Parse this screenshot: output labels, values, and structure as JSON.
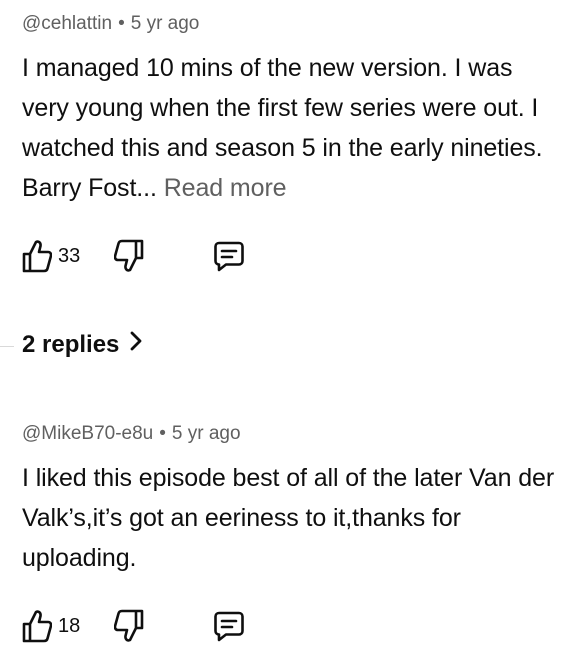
{
  "comments": [
    {
      "author": "@cehlattin",
      "separator": "•",
      "time": "5 yr ago",
      "text": "I managed 10 mins of the new version. I was very young when the first few series were out. I watched this and season 5 in the early nineties. Barry Fost...",
      "read_more": "Read more",
      "likes": "33",
      "icons": {
        "like": "thumbs-up-icon",
        "dislike": "thumbs-down-icon",
        "reply": "comment-reply-icon"
      }
    },
    {
      "author": "@MikeB70-e8u",
      "separator": "•",
      "time": "5 yr ago",
      "text": "I liked this episode best of all of the later Van der Valk’s,it’s got an eeriness to it,thanks for uploading.",
      "likes": "18",
      "icons": {
        "like": "thumbs-up-icon",
        "dislike": "thumbs-down-icon",
        "reply": "comment-reply-icon"
      }
    }
  ],
  "replies_toggle": {
    "label": "2 replies",
    "icon": "chevron-right-icon"
  },
  "colors": {
    "text": "#0f0f0f",
    "meta": "#606060",
    "background": "#ffffff"
  }
}
